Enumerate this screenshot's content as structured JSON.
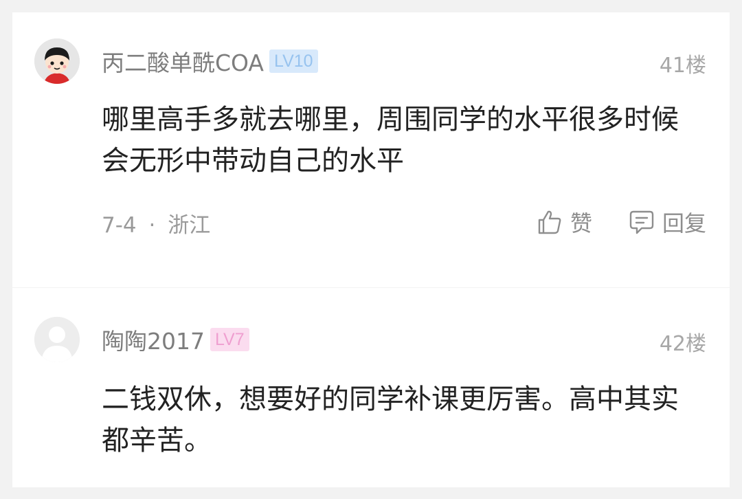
{
  "comments": [
    {
      "username": "丙二酸单酰COA",
      "level": "LV10",
      "floor": "41楼",
      "text": "哪里高手多就去哪里，周围同学的水平很多时候会无形中带动自己的水平",
      "date": "7-4",
      "separator": "·",
      "location": "浙江",
      "avatar_icon": "cartoon-avatar-icon",
      "badge_color": "#d8e9fb",
      "like_label": "赞",
      "reply_label": "回复"
    },
    {
      "username": "陶陶2017",
      "level": "LV7",
      "floor": "42楼",
      "text": "二钱双休，想要好的同学补课更厉害。高中其实都辛苦。",
      "avatar_icon": "default-avatar-icon",
      "badge_color": "#fbdcef"
    }
  ]
}
